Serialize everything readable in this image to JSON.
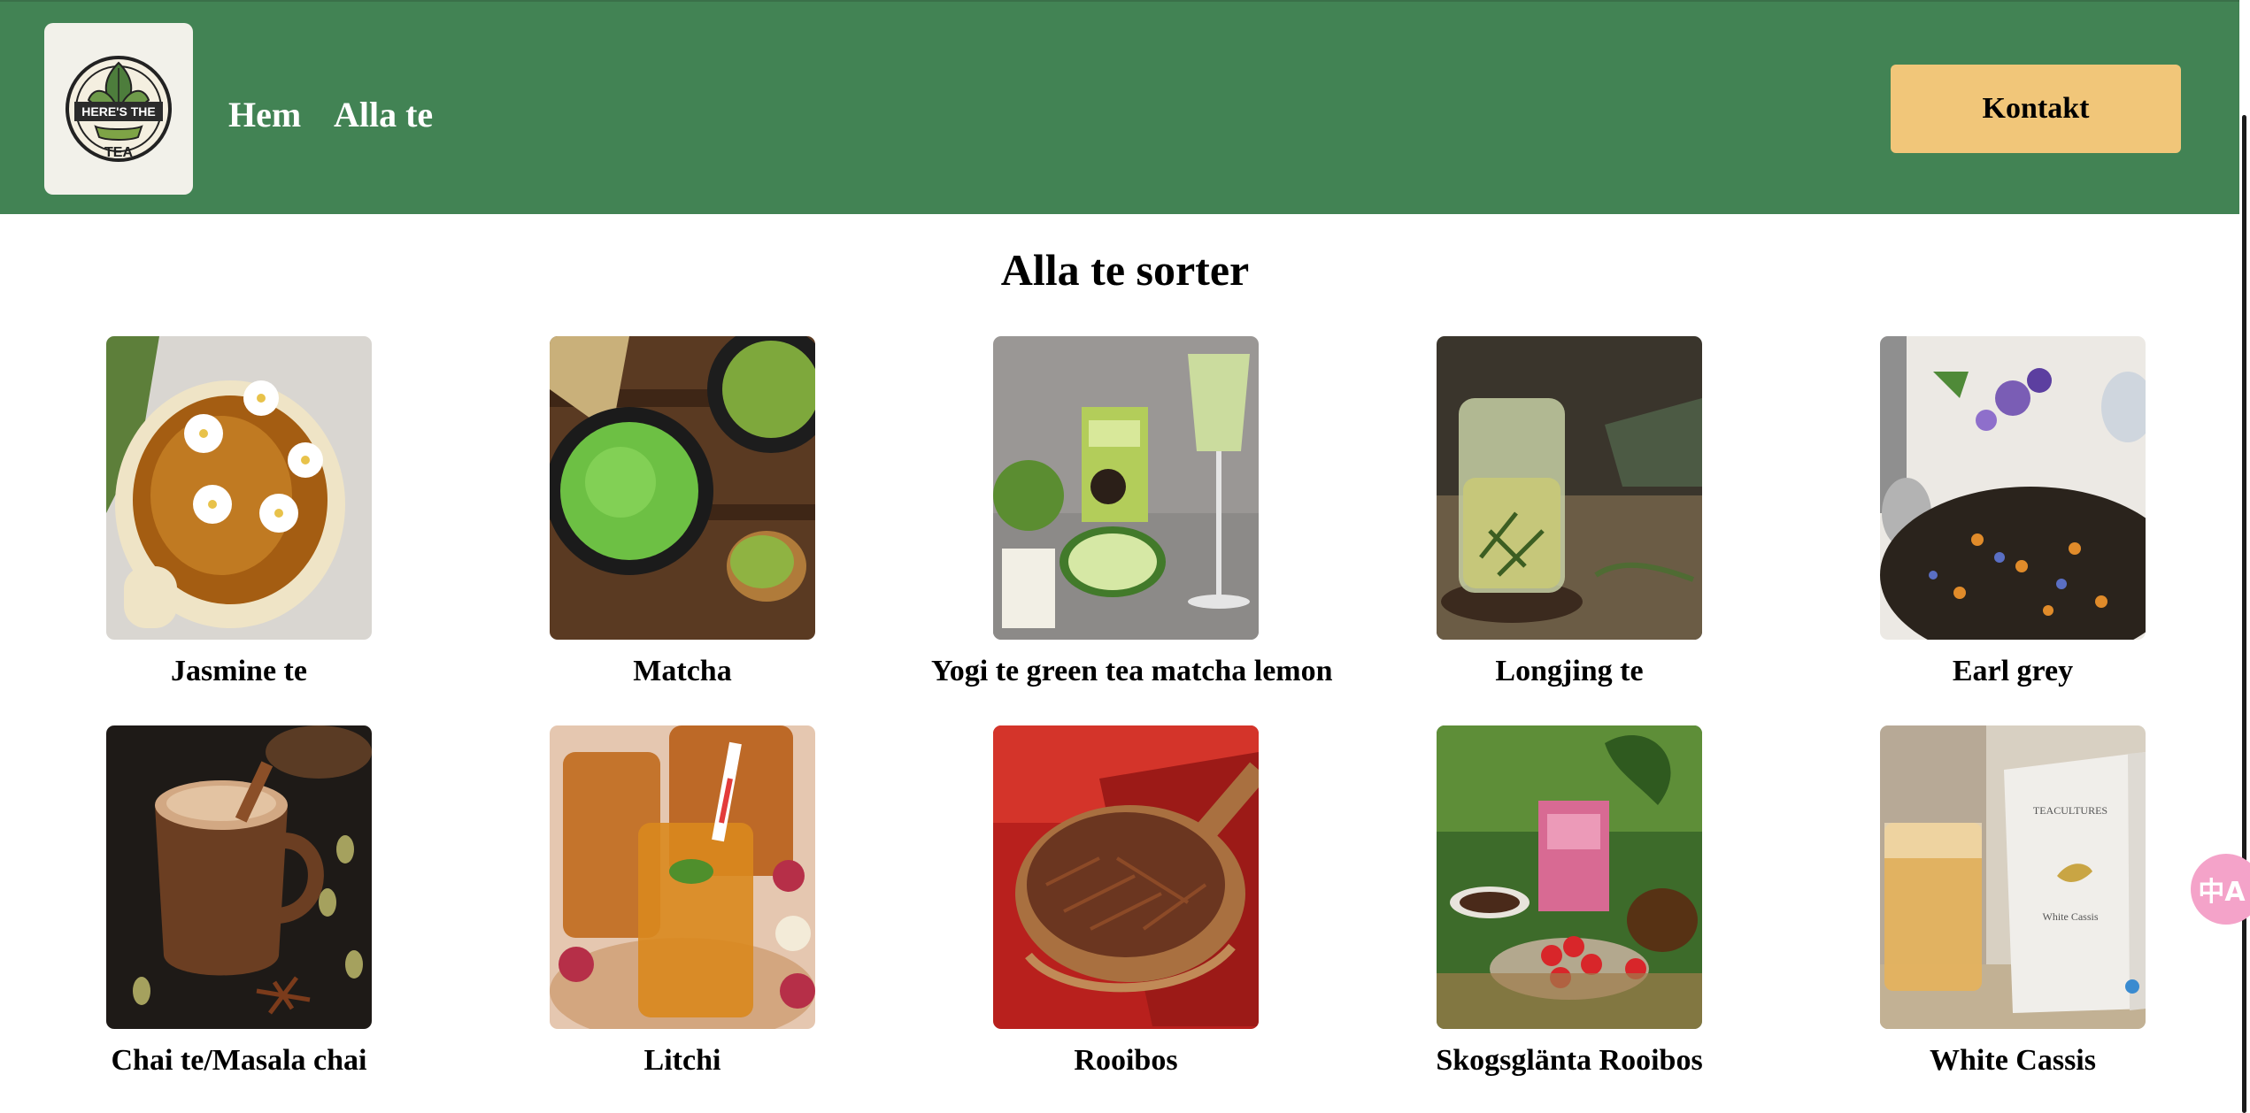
{
  "header": {
    "logo_text_top": "HERE'S THE",
    "logo_text_bottom": "TEA",
    "nav": [
      {
        "label": "Hem"
      },
      {
        "label": "Alla te"
      }
    ],
    "contact_label": "Kontakt",
    "background_color": "#428354",
    "button_color": "#f1c679"
  },
  "main": {
    "title": "Alla te sorter",
    "teas": [
      {
        "name": "Jasmine te",
        "image": "jasmine-tea-photo"
      },
      {
        "name": "Matcha",
        "image": "matcha-photo"
      },
      {
        "name": "Yogi te green tea matcha lemon",
        "image": "yogi-tea-photo"
      },
      {
        "name": "Longjing te",
        "image": "longjing-tea-photo"
      },
      {
        "name": "Earl grey",
        "image": "earl-grey-photo"
      },
      {
        "name": "Chai te/Masala chai",
        "image": "chai-photo"
      },
      {
        "name": "Litchi",
        "image": "litchi-photo"
      },
      {
        "name": "Rooibos",
        "image": "rooibos-photo"
      },
      {
        "name": "Skogsglänta Rooibos",
        "image": "skogsglanta-photo"
      },
      {
        "name": "White Cassis",
        "image": "white-cassis-photo"
      }
    ]
  },
  "translate_widget": {
    "icon": "translate-icon",
    "label": "中A"
  }
}
